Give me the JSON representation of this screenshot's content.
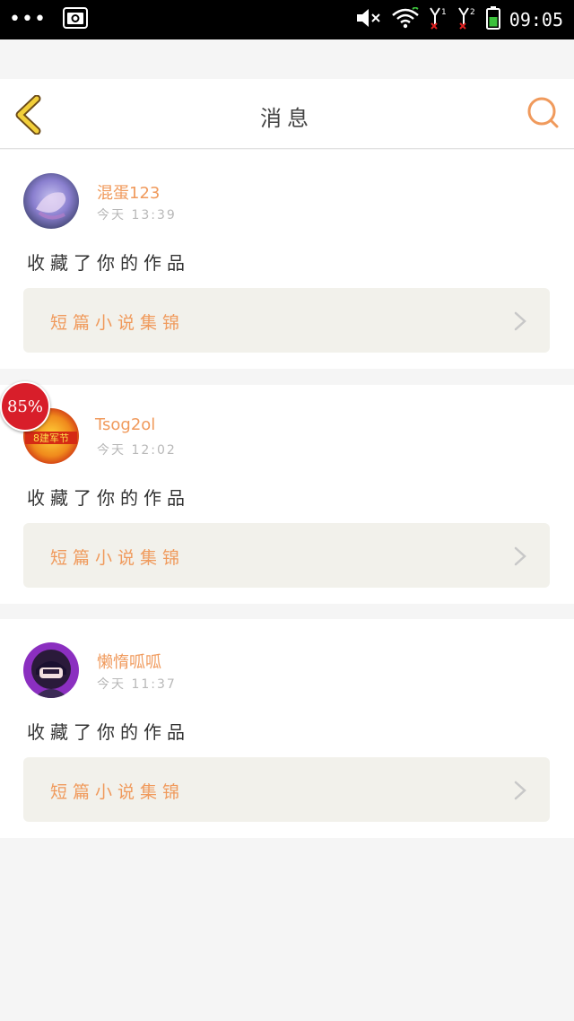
{
  "status_bar": {
    "time": "09:05",
    "icons": [
      "more-dots-icon",
      "camera-icon",
      "volume-muted-icon",
      "wifi-icon",
      "signal-sim1-icon",
      "signal-sim2-icon",
      "battery-icon"
    ]
  },
  "header": {
    "title": "消息"
  },
  "notifications": [
    {
      "username": "混蛋123",
      "time": "今天 13:39",
      "message": "收藏了你的作品",
      "work_title": "短篇小说集锦"
    },
    {
      "username": "Tsog2ol",
      "time": "今天 12:02",
      "message": "收藏了你的作品",
      "work_title": "短篇小说集锦",
      "badge": "85%",
      "avatar_text": "8建军节"
    },
    {
      "username": "懒惰呱呱",
      "time": "今天 11:37",
      "message": "收藏了你的作品",
      "work_title": "短篇小说集锦"
    }
  ],
  "colors": {
    "accent": "#f09a5c",
    "back_icon": "#f2cf3a",
    "card_link_bg": "#f2f1eb",
    "badge": "#d81e2a"
  }
}
